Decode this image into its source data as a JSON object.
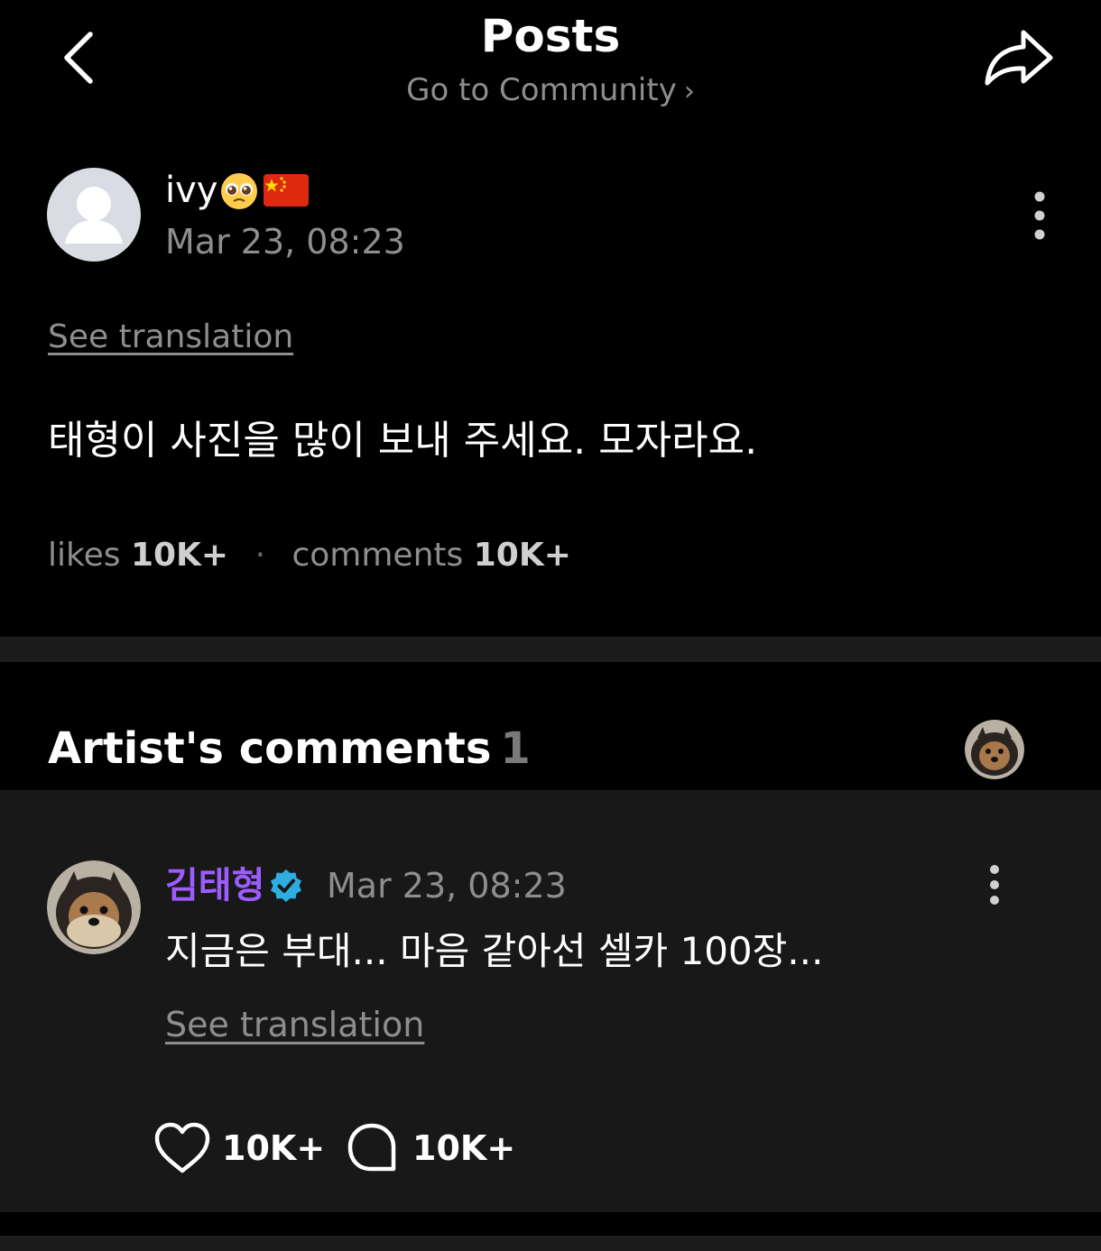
{
  "header": {
    "title": "Posts",
    "subtitle": "Go to Community",
    "back_icon": "chevron-left-icon",
    "share_icon": "share-icon"
  },
  "post": {
    "author": "ivy",
    "author_emoji": "pleading-face",
    "author_flag": "china-flag",
    "date": "Mar 23, 08:23",
    "see_translation": "See translation",
    "body": "태형이 사진을 많이 보내 주세요. 모자라요.",
    "likes_label": "likes",
    "likes_count": "10K+",
    "comments_label": "comments",
    "comments_count": "10K+"
  },
  "artist_comments": {
    "title": "Artist's comments",
    "count": "1",
    "comment": {
      "author": "김태형",
      "verified": true,
      "date": "Mar 23, 08:23",
      "body": "지금은 부대... 마음 같아선 셀카 100장...",
      "see_translation": "See translation",
      "like_count": "10K+",
      "reply_count": "10K+"
    }
  },
  "colors": {
    "background": "#000000",
    "panel": "#181818",
    "divider": "#1c1c1c",
    "muted_text": "#8e8e8e",
    "artist_name": "#9d5cff",
    "verified_badge": "#2eaee0",
    "flag_red": "#de2910",
    "flag_star": "#ffde00"
  }
}
